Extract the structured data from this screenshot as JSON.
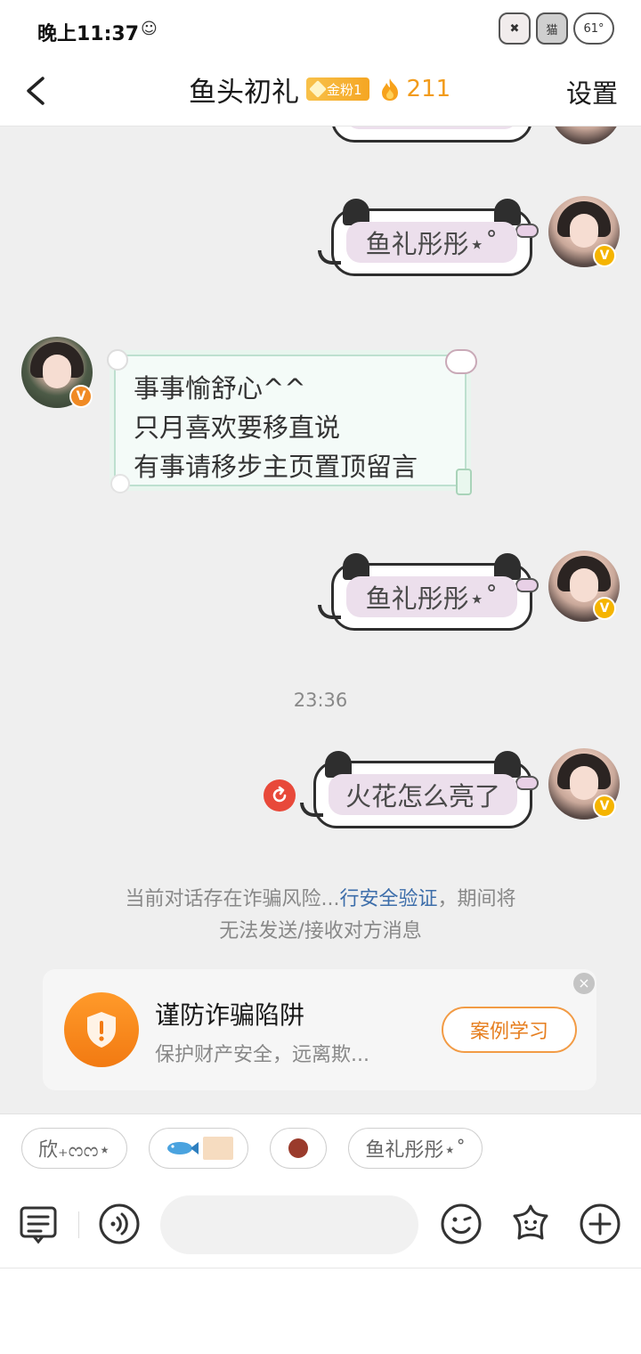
{
  "status_bar": {
    "time": "晚上11:37",
    "emoji": "☺",
    "stickers": [
      "✖",
      "猫",
      "61°"
    ]
  },
  "header": {
    "title": "鱼头初礼",
    "fan_badge": "金粉1",
    "fire_count": "211",
    "settings_label": "设置"
  },
  "messages": [
    {
      "side": "right",
      "text": "鱼礼彤彤⋆˚"
    },
    {
      "side": "left",
      "lines": [
        "事事愉舒心^^",
        "只月喜欢要移直说",
        "有事请移步主页置顶留言"
      ]
    },
    {
      "side": "right",
      "text": "鱼礼彤彤⋆˚"
    },
    {
      "side": "right",
      "text": "火花怎么亮了",
      "failed": true
    }
  ],
  "timestamp": "23:36",
  "system_note": {
    "prefix": "当前对话存在诈骗风险...",
    "link": "行安全验证",
    "suffix": "，期间将",
    "line2": "无法发送/接收对方消息"
  },
  "anti_fraud": {
    "title": "谨防诈骗陷阱",
    "subtitle": "保护财产安全，远离欺...",
    "button": "案例学习"
  },
  "chips": [
    "欣₊ᦂᦂ⋆",
    "鱼礼彤彤⋆˚"
  ],
  "input": {
    "placeholder": ""
  },
  "colors": {
    "accent_orange": "#f29b1a",
    "link_blue": "#3d6eaa",
    "alert_red": "#e8493a",
    "chat_bg": "#efefef"
  },
  "icons": [
    "back-icon",
    "fire-icon",
    "verified-icon",
    "retry-icon",
    "shield-icon",
    "close-icon",
    "chat-list-icon",
    "voice-icon",
    "emoji-icon",
    "sticker-icon",
    "plus-icon"
  ]
}
